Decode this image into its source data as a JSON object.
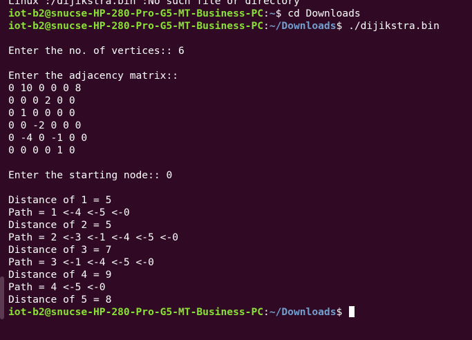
{
  "colors": {
    "background": "#300a24",
    "host": "#8ae234",
    "path": "#729fcf",
    "text": "#ffffff"
  },
  "terminal": {
    "partial_top_line": "Linux :/dijikstra.bin :No such file or directory",
    "prompts": [
      {
        "host": "iot-b2@snucse-HP-280-Pro-G5-MT-Business-PC",
        "sep": ":",
        "path": "~",
        "sym": "$ ",
        "cmd": "cd Downloads"
      },
      {
        "host": "iot-b2@snucse-HP-280-Pro-G5-MT-Business-PC",
        "sep": ":",
        "path": "~/Downloads",
        "sym": "$ ",
        "cmd": "./dijikstra.bin"
      },
      {
        "host": "iot-b2@snucse-HP-280-Pro-G5-MT-Business-PC",
        "sep": ":",
        "path": "~/Downloads",
        "sym": "$ ",
        "cmd": ""
      }
    ],
    "vertices_line": "Enter the no. of vertices:: 6",
    "matrix_prompt": "Enter the adjacency matrix::",
    "matrix_rows": [
      "0 10 0 0 0 8",
      "0 0 0 2 0 0",
      "0 1 0 0 0 0",
      "0 0 -2 0 0 0",
      "0 -4 0 -1 0 0",
      "0 0 0 0 1 0"
    ],
    "start_line": "Enter the starting node:: 0",
    "results": [
      "Distance of 1 = 5",
      "Path = 1 <-4 <-5 <-0",
      "Distance of 2 = 5",
      "Path = 2 <-3 <-1 <-4 <-5 <-0",
      "Distance of 3 = 7",
      "Path = 3 <-1 <-4 <-5 <-0",
      "Distance of 4 = 9",
      "Path = 4 <-5 <-0",
      "Distance of 5 = 8"
    ]
  }
}
